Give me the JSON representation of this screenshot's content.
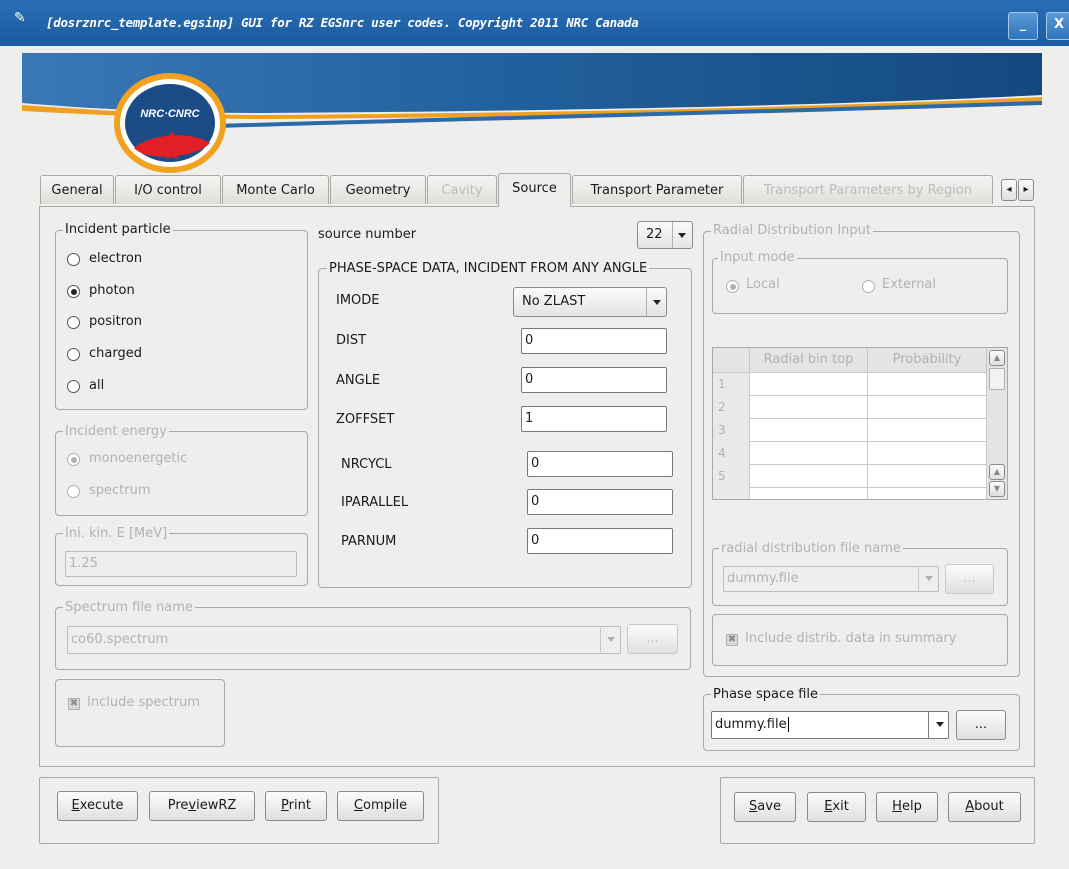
{
  "window": {
    "title": "[dosrznrc_template.egsinp] GUI for RZ EGSnrc user codes. Copyright 2011 NRC Canada",
    "minimize_label": "_",
    "close_label": "X",
    "logo_text": "NRC·CNRC"
  },
  "tabs": [
    {
      "label": "General"
    },
    {
      "label": "I/O control"
    },
    {
      "label": "Monte Carlo"
    },
    {
      "label": "Geometry"
    },
    {
      "label": "Cavity"
    },
    {
      "label": "Source"
    },
    {
      "label": "Transport Parameter"
    },
    {
      "label": "Transport Parameters by Region"
    }
  ],
  "tab_scroll": {
    "left": "◂",
    "right": "▸"
  },
  "incident_particle": {
    "title": "Incident particle",
    "options": [
      "electron",
      "photon",
      "positron",
      "charged",
      "all"
    ],
    "selected": "photon"
  },
  "incident_energy": {
    "title": "Incident energy",
    "options": [
      "monoenergetic",
      "spectrum"
    ],
    "selected": "monoenergetic"
  },
  "ini_kin_e": {
    "title": "Ini. kin. E [MeV]",
    "value": "1.25"
  },
  "spectrum_file": {
    "title": "Spectrum file name",
    "value": "co60.spectrum",
    "browse_label": "..."
  },
  "include_spectrum": {
    "label": "Include spectrum",
    "mark": "✖"
  },
  "source_number": {
    "label": "source number",
    "value": "22"
  },
  "phase_space": {
    "title": "PHASE-SPACE DATA, INCIDENT FROM ANY ANGLE",
    "imode": {
      "label": "IMODE",
      "value": "No ZLAST"
    },
    "dist": {
      "label": "DIST",
      "value": "0"
    },
    "angle": {
      "label": "ANGLE",
      "value": "0"
    },
    "zoffset": {
      "label": "ZOFFSET",
      "value": "1"
    },
    "nrcycl": {
      "label": "NRCYCL",
      "value": "0"
    },
    "iparallel": {
      "label": "IPARALLEL",
      "value": "0"
    },
    "parnum": {
      "label": "PARNUM",
      "value": "0"
    }
  },
  "radial": {
    "title": "Radial Distribution Input",
    "input_mode": {
      "title": "Input mode",
      "options": [
        "Local",
        "External"
      ],
      "selected": "Local"
    },
    "table": {
      "headers": [
        "Radial bin top",
        "Probability"
      ],
      "rows": [
        "1",
        "2",
        "3",
        "4",
        "5"
      ]
    },
    "file_title": "radial distribution file name",
    "file_value": "dummy.file",
    "browse_label": "...",
    "include_label": "Include distrib. data in summary",
    "include_mark": "✖"
  },
  "phase_space_file": {
    "title": "Phase space file",
    "value": "dummy.file",
    "browse_label": "..."
  },
  "bottom_left_buttons": [
    {
      "key": "E",
      "rest": "xecute"
    },
    {
      "pre": "Pre",
      "key": "v",
      "rest": "iewRZ"
    },
    {
      "key": "P",
      "rest": "rint"
    },
    {
      "key": "C",
      "rest": "ompile"
    }
  ],
  "bottom_right_buttons": [
    {
      "key": "S",
      "rest": "ave"
    },
    {
      "key": "E",
      "rest": "xit"
    },
    {
      "key": "H",
      "rest": "elp"
    },
    {
      "key": "A",
      "rest": "bout"
    }
  ]
}
